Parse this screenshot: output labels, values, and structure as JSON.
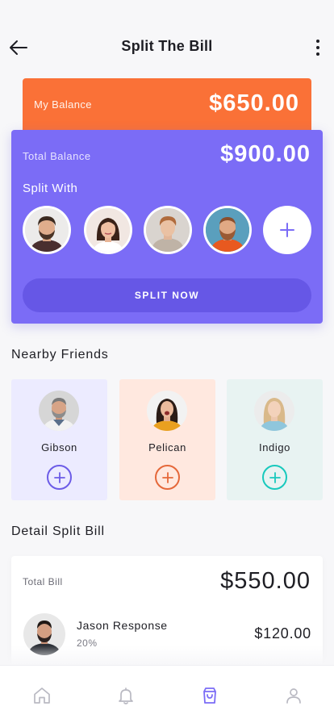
{
  "header": {
    "title": "Split The Bill",
    "back_icon": "arrow-left-icon",
    "more_icon": "more-vertical-icon"
  },
  "my_balance": {
    "label": "My Balance",
    "amount": "$650.00",
    "color": "#fa7137"
  },
  "total": {
    "label": "Total Balance",
    "amount": "$900.00",
    "split_with_label": "Split With",
    "add_icon": "plus-icon",
    "button_label": "SPLIT NOW",
    "color": "#7b6cf6"
  },
  "nearby": {
    "title": "Nearby Friends",
    "friends": [
      {
        "name": "Gibson",
        "color": "#ecebff",
        "accent": "#6c5ce7"
      },
      {
        "name": "Pelican",
        "color": "#ffe8df",
        "accent": "#e5683a"
      },
      {
        "name": "Indigo",
        "color": "#e8f3f2",
        "accent": "#18c9bd"
      }
    ]
  },
  "detail": {
    "title": "Detail Split Bill",
    "total_label": "Total Bill",
    "total_amount": "$550.00",
    "person": {
      "name": "Jason Response",
      "percent": "20%",
      "amount": "$120.00"
    }
  },
  "nav": [
    {
      "icon": "home-icon",
      "active": false
    },
    {
      "icon": "bell-icon",
      "active": false
    },
    {
      "icon": "shopping-bag-icon",
      "active": true
    },
    {
      "icon": "user-icon",
      "active": false
    }
  ]
}
